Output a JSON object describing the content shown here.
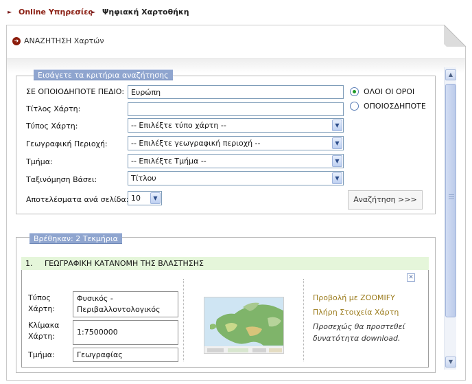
{
  "breadcrumb": {
    "link": "Online Υπηρεσίες",
    "current": "Ψηφιακή Χαρτοθήκη"
  },
  "page_title": "ΑΝΑΖΗΤΗΣΗ Χαρτών",
  "search": {
    "legend": "Εισάγετε τα κριτήρια αναζήτησης",
    "any_field_label": "ΣΕ ΟΠΟΙΟΔΗΠΟΤΕ ΠΕΔΙΟ:",
    "any_field_value": "Ευρώπη",
    "title_label": "Τίτλος Χάρτη:",
    "title_value": "",
    "type_label": "Τύπος Χάρτη:",
    "type_value": "-- Επιλέξτε τύπο χάρτη --",
    "region_label": "Γεωγραφική Περιοχή:",
    "region_value": "-- Επιλέξτε γεωγραφική περιοχή --",
    "section_label": "Τμήμα:",
    "section_value": "-- Επιλέξτε Τμήμα --",
    "sort_label": "Ταξινόμηση Βάσει:",
    "sort_value": "Τίτλου",
    "per_page_label": "Αποτελέσματα ανά σελίδα:",
    "per_page_value": "10",
    "radio_all": "ΟΛΟΙ ΟΙ ΟΡΟΙ",
    "radio_any": "ΟΠΟΙΟΣΔΗΠΟΤΕ",
    "radio_selected": "all",
    "search_button": "Αναζήτηση >>>"
  },
  "results": {
    "legend": "Βρέθηκαν: 2 Τεκμήρια",
    "items": [
      {
        "number": "1.",
        "title": "ΓΕΩΓΡΑΦΙΚΗ ΚΑΤΑΝΟΜΗ ΤΗΣ ΒΛΑΣΤΗΣΗΣ",
        "type_label": "Τύπος Χάρτη:",
        "type_value": "Φυσικός - Περιβαλλοντολογικός",
        "scale_label": "Κλίμακα Χάρτη:",
        "scale_value": "1:7500000",
        "section_label": "Τμήμα:",
        "section_value": "Γεωγραφίας",
        "zoomify_link": "Προβολή με ZOOMIFY",
        "details_link": "Πλήρη Στοιχεία Χάρτη",
        "download_note": "Προσεχώς θα προστεθεί δυνατότητα download."
      }
    ]
  },
  "colors": {
    "breadcrumb_link": "#8a1e12",
    "legend_bg": "#8fa5cf",
    "result_bar_bg": "#e5f6da",
    "link_color": "#9a7a1a",
    "radio_selected_dot": "#1f9a2a"
  }
}
